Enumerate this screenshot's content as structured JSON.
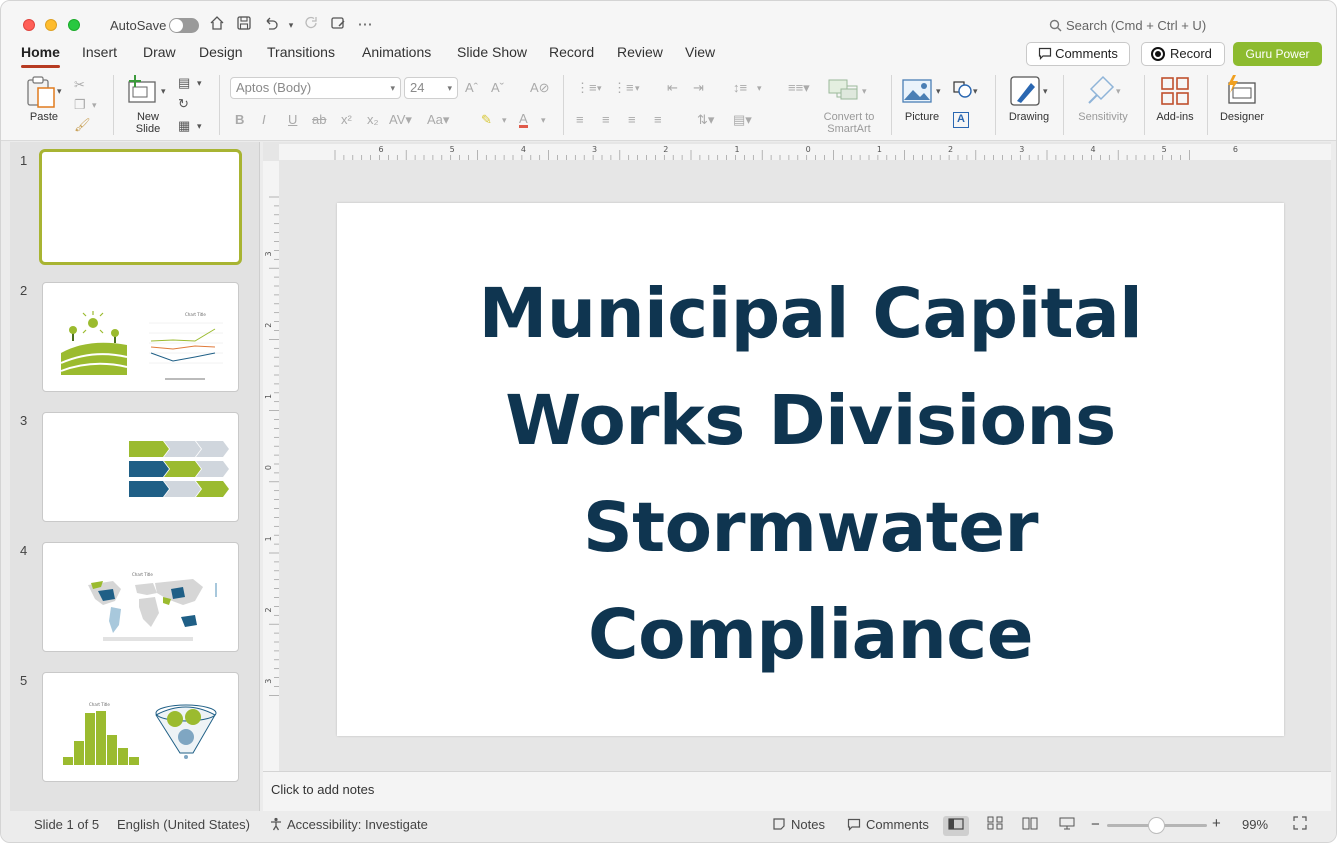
{
  "quick_access": {
    "autosave_label": "AutoSave"
  },
  "search": {
    "placeholder": "Search (Cmd + Ctrl + U)"
  },
  "tabs": [
    "Home",
    "Insert",
    "Draw",
    "Design",
    "Transitions",
    "Animations",
    "Slide Show",
    "Record",
    "Review",
    "View"
  ],
  "active_tab": "Home",
  "header_buttons": {
    "comments": "Comments",
    "record": "Record",
    "guru": "Guru Power"
  },
  "ribbon": {
    "paste": "Paste",
    "new_slide_line1": "New",
    "new_slide_line2": "Slide",
    "font_name": "Aptos (Body)",
    "font_size": "24",
    "convert_line1": "Convert to",
    "convert_line2": "SmartArt",
    "picture": "Picture",
    "drawing": "Drawing",
    "sensitivity": "Sensitivity",
    "addins": "Add-ins",
    "designer": "Designer"
  },
  "slides": [
    {
      "number": "1"
    },
    {
      "number": "2"
    },
    {
      "number": "3"
    },
    {
      "number": "4"
    },
    {
      "number": "5"
    }
  ],
  "thumb_text": {
    "chart_title": "Chart Title"
  },
  "current_slide": {
    "title_lines": [
      "Municipal Capital",
      "Works Divisions",
      "Stormwater",
      "Compliance"
    ]
  },
  "ruler": {
    "h_labels": [
      "6",
      "5",
      "4",
      "3",
      "2",
      "1",
      "0",
      "1",
      "2",
      "3",
      "4",
      "5",
      "6"
    ],
    "v_labels": [
      "3",
      "2",
      "1",
      "0",
      "1",
      "2",
      "3"
    ]
  },
  "notes_placeholder": "Click to add notes",
  "status": {
    "slide_position": "Slide 1 of 5",
    "language": "English (United States)",
    "accessibility": "Accessibility: Investigate",
    "notes": "Notes",
    "comments": "Comments",
    "zoom": "99%"
  },
  "colors": {
    "accent_green": "#8dbb2f",
    "title_navy": "#0f3550",
    "tab_underline": "#b73b22",
    "selected_border": "#a8b432"
  }
}
